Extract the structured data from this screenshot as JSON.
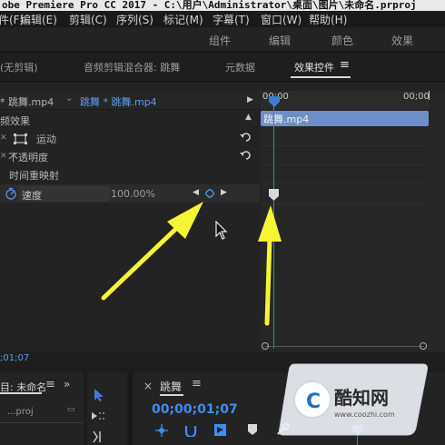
{
  "window": {
    "title": "obe Premiere Pro CC 2017 - C:\\用户\\Administrator\\桌面\\图片\\未命名.prproj"
  },
  "menubar": {
    "items": [
      {
        "label": "件(F)"
      },
      {
        "label": "编辑(E)"
      },
      {
        "label": "剪辑(C)"
      },
      {
        "label": "序列(S)"
      },
      {
        "label": "标记(M)"
      },
      {
        "label": "字幕(T)"
      },
      {
        "label": "窗口(W)"
      },
      {
        "label": "帮助(H)"
      }
    ]
  },
  "workspaces": [
    {
      "label": "组件"
    },
    {
      "label": "编辑"
    },
    {
      "label": "颜色"
    },
    {
      "label": "效果"
    }
  ],
  "panel_tabs": {
    "source": "(无剪辑)",
    "audio_mixer": "音频剪辑混合器: 跳舞",
    "metadata": "元数据",
    "effect_controls": "效果控件",
    "menu_icon": "≡"
  },
  "effect_controls": {
    "master_clip": "* 跳舞.mp4",
    "sequence_clip": "跳舞 * 跳舞.mp4",
    "section_label": "频效果",
    "motion_label": "运动",
    "opacity_label": "不透明度",
    "time_remap_label": "时间重映射",
    "speed_label": "速度",
    "speed_value": "100.00%",
    "fx_label": "fx"
  },
  "ec_timeline": {
    "ruler_start": "00;00",
    "ruler_end": "00;00",
    "clip_name": "跳舞.mp4"
  },
  "timecode_bottom": ";01;07",
  "project_panel": {
    "title": "目: 未命名",
    "file": "...proj",
    "menu_icon": "≡",
    "more": "»"
  },
  "sequence_panel": {
    "close": "×",
    "name": "跳舞",
    "menu_icon": "≡",
    "timecode": "00;00;01;07"
  },
  "watermark": {
    "brand": "酷知网",
    "url": "www.coozhi.com"
  },
  "colors": {
    "accent_blue": "#3d7cd6",
    "clip_blue": "#6d8fc6",
    "arrow_yellow": "#f5f535",
    "panel_bg": "#232323"
  },
  "icons": [
    "reset-icon",
    "stopwatch-icon",
    "keyframe-diamond-icon",
    "prev-keyframe-icon",
    "next-keyframe-icon",
    "selection-tool-icon",
    "mouse-cursor-icon",
    "wrench-icon",
    "marker-icon"
  ]
}
